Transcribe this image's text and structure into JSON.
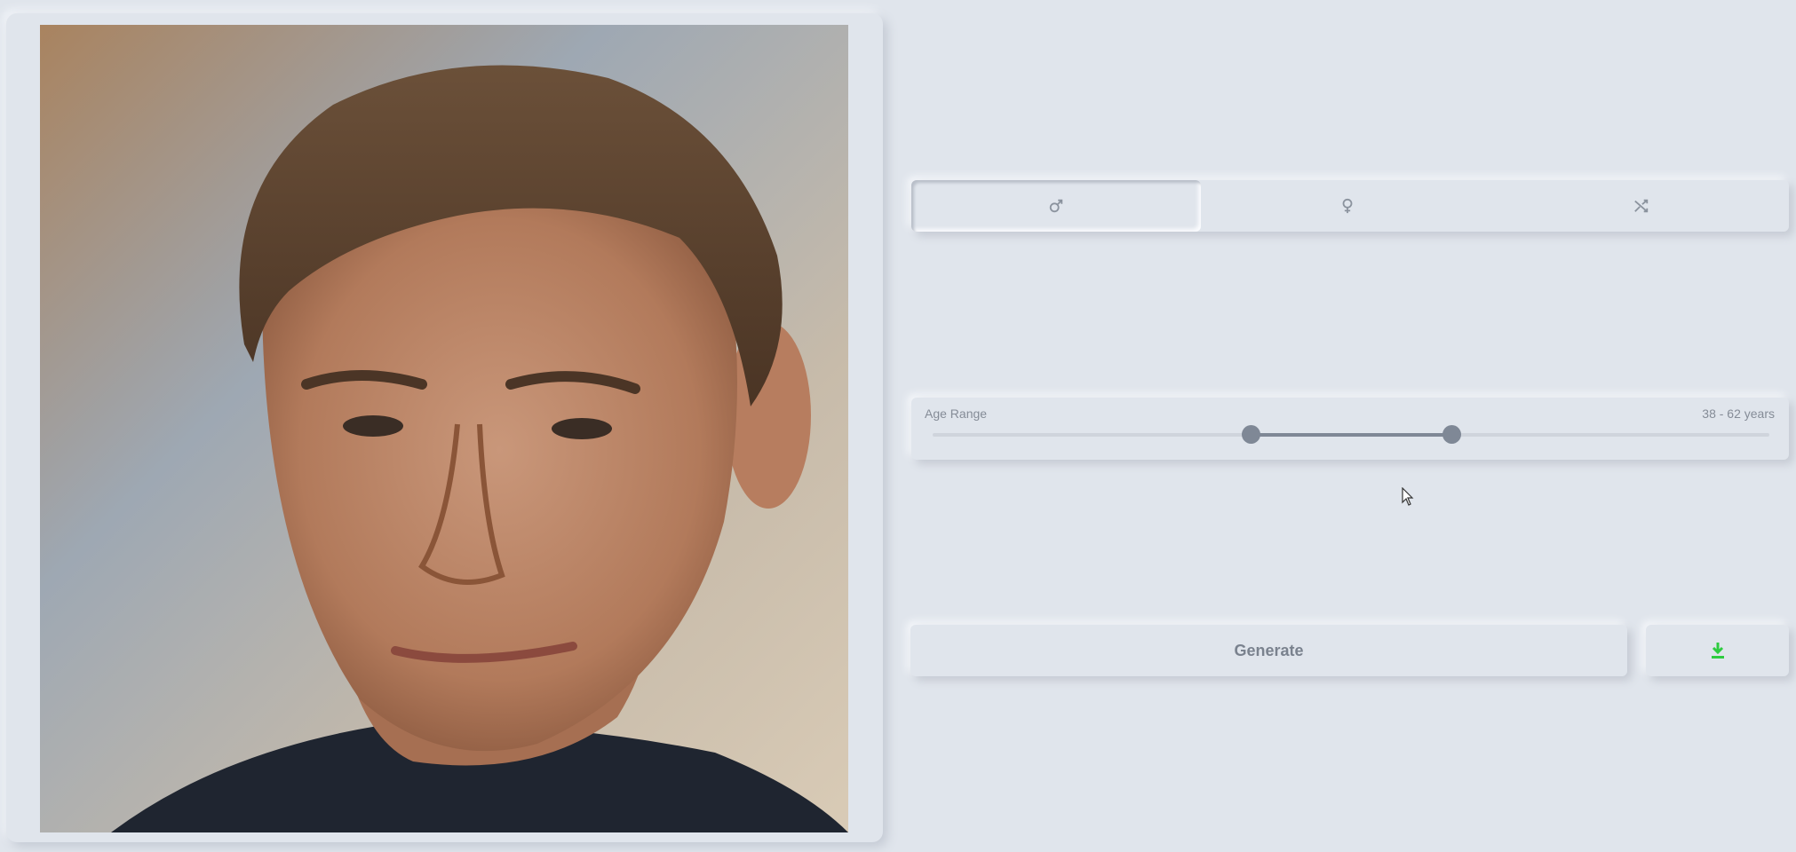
{
  "photo": {
    "alt": "Generated face portrait"
  },
  "gender_selector": {
    "options": [
      {
        "name": "male",
        "icon": "male-icon",
        "active": true
      },
      {
        "name": "female",
        "icon": "female-icon",
        "active": false
      },
      {
        "name": "random",
        "icon": "shuffle-icon",
        "active": false
      }
    ]
  },
  "age_range": {
    "label": "Age Range",
    "value_text": "38 - 62 years",
    "min_fraction": 0.38,
    "max_fraction": 0.62
  },
  "actions": {
    "generate_label": "Generate",
    "download_icon": "download-icon",
    "download_color": "#2ecc40"
  },
  "colors": {
    "background": "#e0e5ec",
    "slider_fill": "#7f8896"
  }
}
